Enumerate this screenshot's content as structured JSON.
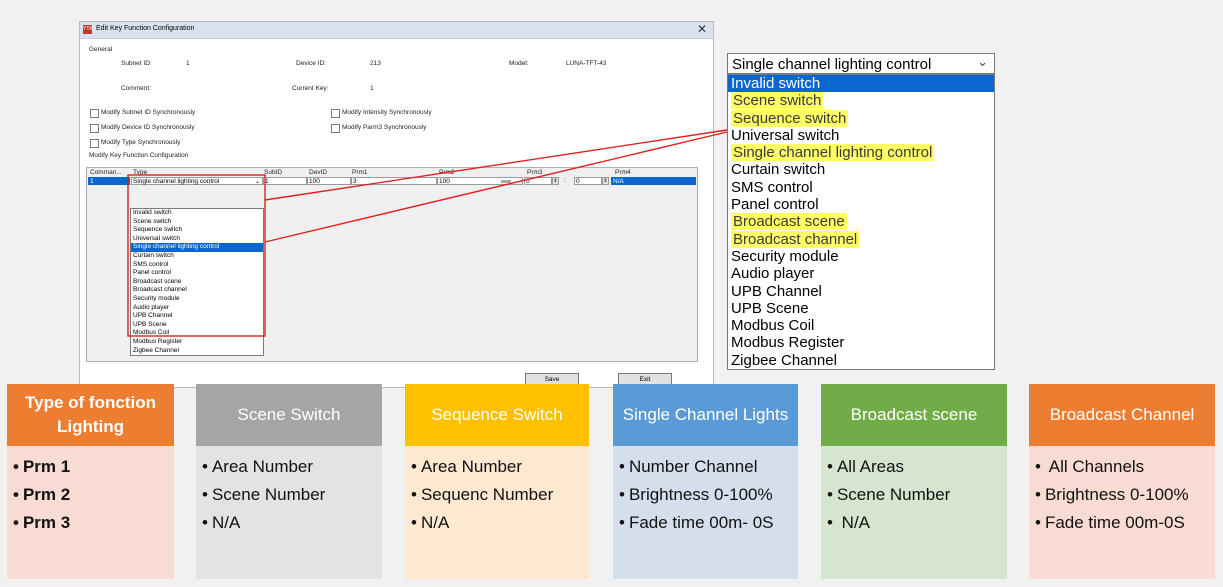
{
  "window": {
    "title": "Edit Key Function Configuration",
    "app_icon_text": "YTK",
    "close_glyph": "✕",
    "general_label": "General",
    "subnet_id_label": "Subnet ID:",
    "subnet_id_value": "1",
    "device_id_label": "Device ID:",
    "device_id_value": "213",
    "model_label": "Model:",
    "model_value": "LUNA-TFT-43",
    "comment_label": "Comment:",
    "current_key_label": "Current Key:",
    "current_key_value": "1",
    "checkboxes": [
      "Modify Subnet ID Synchronously",
      "Modify Intensity Synchronously",
      "Modify Device ID Synchronously",
      "Modify Parm3 Synchronously",
      "Modify Type Synchronously"
    ],
    "section_label": "Modify Key Function Configuration",
    "columns": [
      "Comman...",
      "Type",
      "SubID",
      "DevID",
      "Prm1",
      "Prm2",
      "Prm3",
      "Prm4"
    ],
    "row": {
      "command": "1",
      "type": "Single channel lighting control",
      "subid": "1",
      "devid": "100",
      "prm1": "3",
      "prm2": "100",
      "prm3a": "0",
      "prm3sep": ":",
      "prm3b": "0",
      "prm4": "N/A"
    },
    "type_options": [
      "Invalid switch",
      "Scene switch",
      "Sequence switch",
      "Universal switch",
      "Single channel lighting control",
      "Curtain switch",
      "SMS control",
      "Panel control",
      "Broadcast scene",
      "Broadcast channel",
      "Security module",
      "Audio player",
      "UPB Channel",
      "UPB Scene",
      "Modbus Coil",
      "Modbus Register",
      "Zigbee Channel"
    ],
    "save_label": "Save",
    "exit_label": "Exit"
  },
  "zoom": {
    "selected": "Single channel lighting control",
    "chevron": "⌄",
    "items": [
      {
        "label": "Invalid switch",
        "state": "selected"
      },
      {
        "label": "Scene switch",
        "state": "highlight"
      },
      {
        "label": "Sequence switch",
        "state": "highlight"
      },
      {
        "label": "Universal switch",
        "state": "normal"
      },
      {
        "label": "Single channel lighting control",
        "state": "highlight"
      },
      {
        "label": "Curtain switch",
        "state": "normal"
      },
      {
        "label": "SMS control",
        "state": "normal"
      },
      {
        "label": "Panel control",
        "state": "normal"
      },
      {
        "label": "Broadcast scene",
        "state": "highlight"
      },
      {
        "label": "Broadcast channel",
        "state": "highlight"
      },
      {
        "label": "Security module",
        "state": "normal"
      },
      {
        "label": "Audio player",
        "state": "normal"
      },
      {
        "label": "UPB Channel",
        "state": "normal"
      },
      {
        "label": "UPB Scene",
        "state": "normal"
      },
      {
        "label": "Modbus Coil",
        "state": "normal"
      },
      {
        "label": "Modbus Register",
        "state": "normal"
      },
      {
        "label": "Zigbee Channel",
        "state": "normal"
      }
    ],
    "highlight_color": "#ffff66",
    "selection_color": "#0a66d0",
    "connector_color": "#e02020"
  },
  "cards": [
    {
      "title": "Type of fonction Lighting",
      "head_color": "#ed7d31",
      "body_color": "#f8dcd3",
      "bold": true,
      "items": [
        "Prm 1",
        "Prm 2",
        "Prm 3"
      ]
    },
    {
      "title": "Scene Switch",
      "head_color": "#a5a5a5",
      "body_color": "#e3e3e3",
      "bold": false,
      "items": [
        "Area Number",
        "Scene Number",
        "N/A"
      ]
    },
    {
      "title": "Sequence Switch",
      "head_color": "#ffc000",
      "body_color": "#fde9d0",
      "bold": false,
      "items": [
        "Area Number",
        "Sequenc Number",
        "N/A"
      ]
    },
    {
      "title": "Single Channel Lights",
      "head_color": "#5b9bd5",
      "body_color": "#d5deec",
      "bold": false,
      "items": [
        "Number Channel",
        "Brightness 0-100%",
        "Fade time 00m- 0S"
      ]
    },
    {
      "title": "Broadcast scene",
      "head_color": "#70ad47",
      "body_color": "#d6e5d0",
      "bold": false,
      "items": [
        "All Areas",
        "Scene Number",
        " N/A"
      ]
    },
    {
      "title": "Broadcast Channel",
      "head_color": "#ed7d31",
      "body_color": "#f8dcd3",
      "bold": false,
      "items": [
        " All Channels",
        "Brightness 0-100%",
        "Fade time 00m-0S"
      ]
    }
  ]
}
